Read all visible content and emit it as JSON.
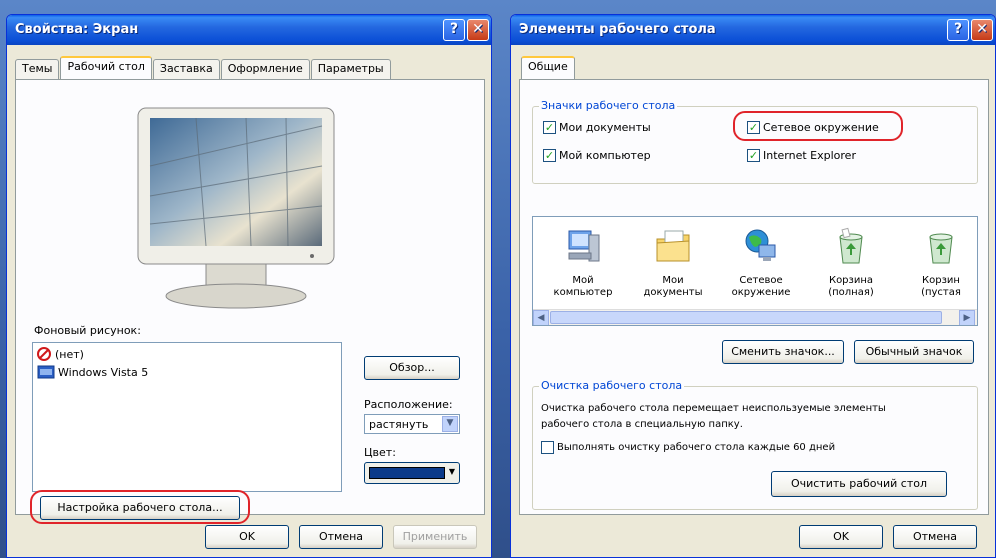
{
  "left": {
    "title": "Свойства: Экран",
    "tabs": [
      "Темы",
      "Рабочий стол",
      "Заставка",
      "Оформление",
      "Параметры"
    ],
    "background_label": "Фоновый рисунок:",
    "bg_items": [
      "(нет)",
      "Windows Vista 5"
    ],
    "browse_button": "Обзор...",
    "position_label": "Расположение:",
    "position_value": "растянуть",
    "color_label": "Цвет:",
    "customize_button": "Настройка рабочего стола...",
    "ok": "OK",
    "cancel": "Отмена",
    "apply": "Применить"
  },
  "right": {
    "title": "Элементы рабочего стола",
    "tab": "Общие",
    "icons_group": "Значки рабочего стола",
    "cb_my_docs": "Мои документы",
    "cb_network": "Сетевое окружение",
    "cb_my_computer": "Мой компьютер",
    "cb_ie": "Internet Explorer",
    "tiles": [
      [
        "Мой",
        "компьютер"
      ],
      [
        "Мои",
        "документы"
      ],
      [
        "Сетевое",
        "окружение"
      ],
      [
        "Корзина",
        "(полная)"
      ],
      [
        "Корзин",
        "(пустая"
      ]
    ],
    "change_icon": "Сменить значок...",
    "default_icon": "Обычный значок",
    "cleanup_group": "Очистка рабочего стола",
    "cleanup_text_1": "Очистка рабочего стола перемещает неиспользуемые элементы",
    "cleanup_text_2": "рабочего стола в специальную папку.",
    "cleanup_cb": "Выполнять очистку рабочего стола каждые 60 дней",
    "cleanup_button": "Очистить рабочий стол",
    "ok": "OK",
    "cancel": "Отмена"
  },
  "colors": {
    "highlight": "#e0242a",
    "title_blue": "#0b4fd6",
    "swatch": "#0b3a8a"
  }
}
